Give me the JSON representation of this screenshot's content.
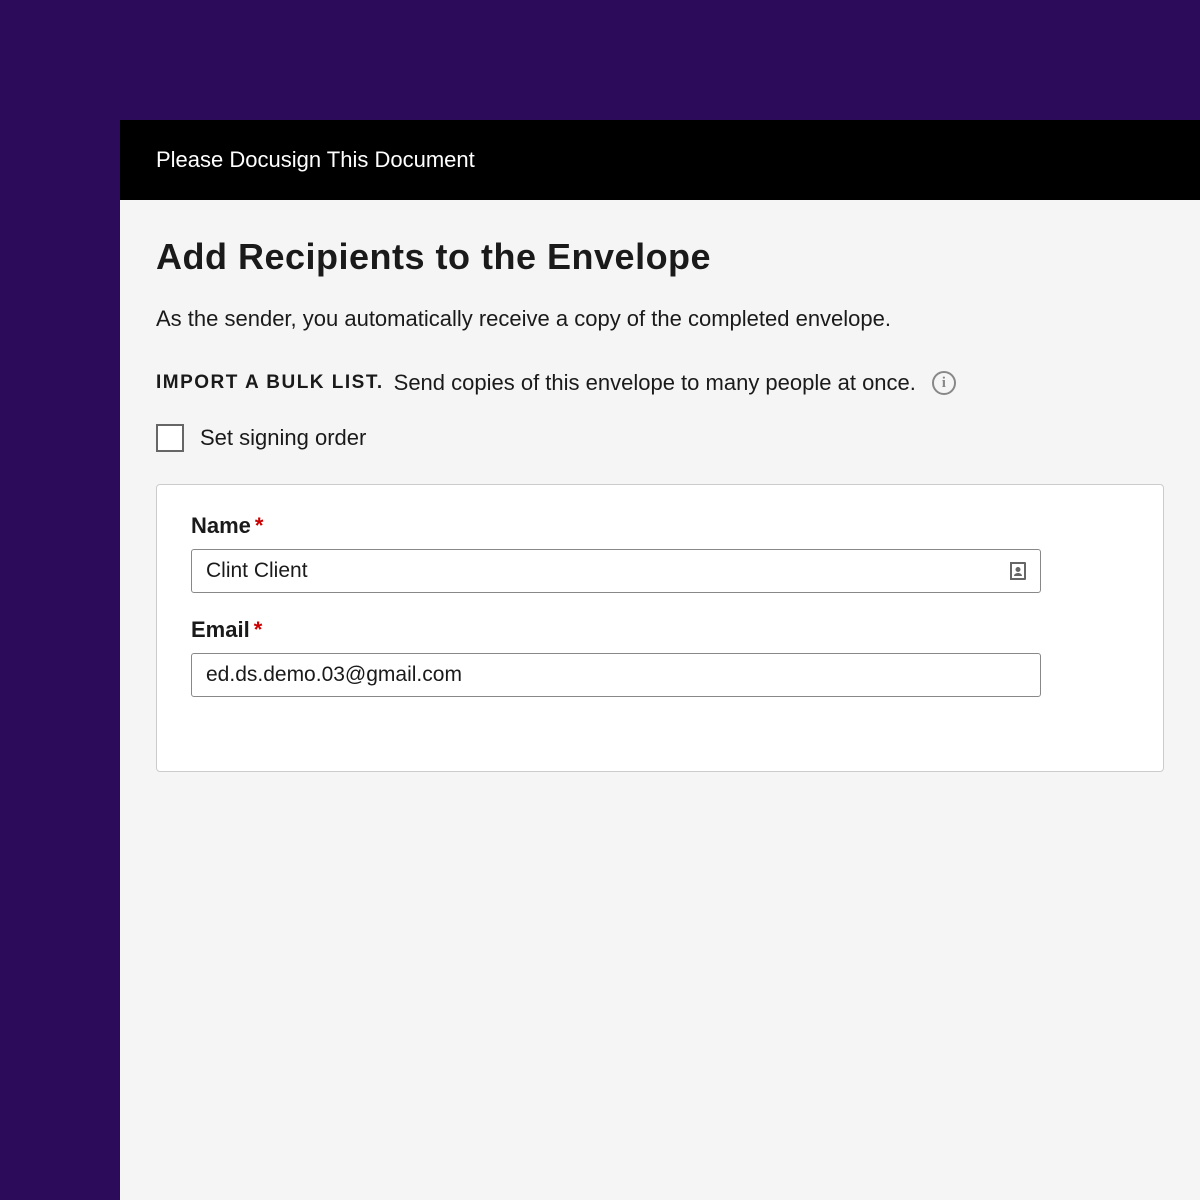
{
  "header": {
    "title": "Please Docusign This Document"
  },
  "page": {
    "heading": "Add Recipients to the Envelope",
    "subtext": "As the sender, you automatically receive a copy of the completed envelope."
  },
  "bulk": {
    "link_label": "IMPORT A BULK LIST",
    "description": "Send copies of this envelope to many people at once."
  },
  "signing_order": {
    "label": "Set signing order",
    "checked": false
  },
  "recipient": {
    "name_label": "Name",
    "name_value": "Clint Client",
    "email_label": "Email",
    "email_value": "ed.ds.demo.03@gmail.com"
  },
  "icons": {
    "info": "info-icon",
    "contact": "contact-book-icon"
  }
}
